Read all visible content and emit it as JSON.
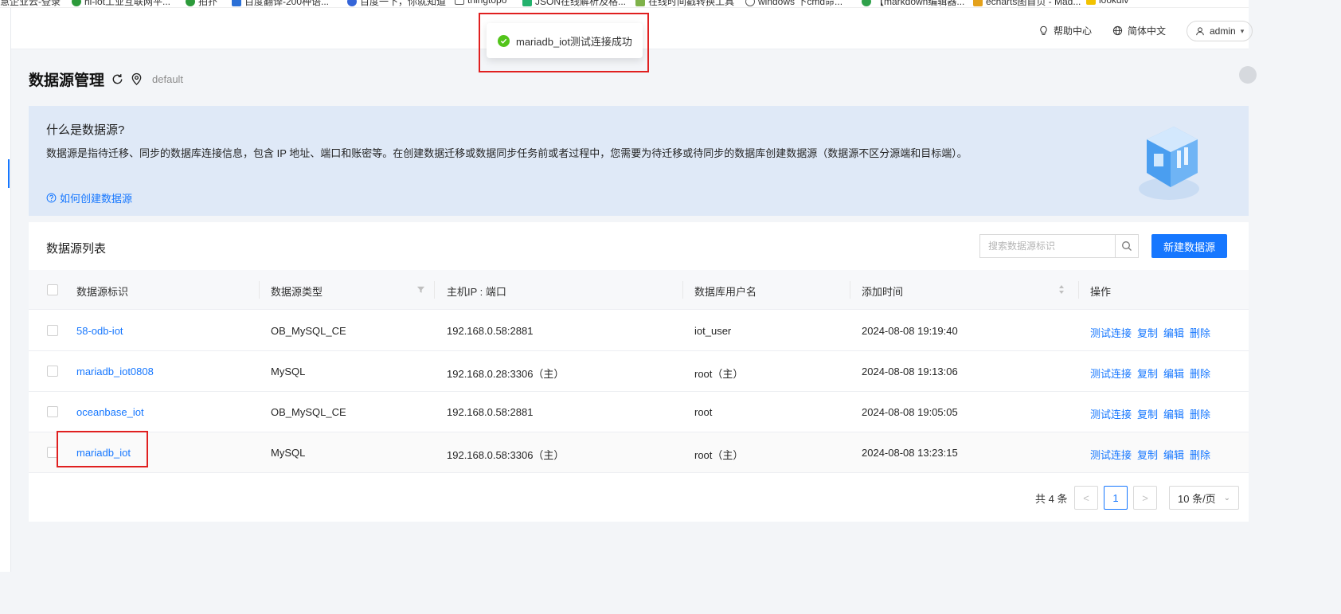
{
  "bookmarks": [
    {
      "label": "慧企业云-登录"
    },
    {
      "label": "hi-iot工业互联网平..."
    },
    {
      "label": "拍扑"
    },
    {
      "label": "百度翻译-200种语..."
    },
    {
      "label": "百度一下，你就知道"
    },
    {
      "label": "thingtopo"
    },
    {
      "label": "JSON在线解析及格..."
    },
    {
      "label": "在线时间戳转换工具"
    },
    {
      "label": "windows 下cmd命..."
    },
    {
      "label": "【markdown编辑器..."
    },
    {
      "label": "echarts图首页 - Mad..."
    },
    {
      "label": "lookdiv"
    }
  ],
  "header": {
    "help": "帮助中心",
    "language": "简体中文",
    "user": "admin"
  },
  "toast": {
    "message": "mariadb_iot测试连接成功",
    "status_color": "#52c41a"
  },
  "page": {
    "title": "数据源管理",
    "namespace": "default"
  },
  "banner": {
    "title": "什么是数据源?",
    "description": "数据源是指待迁移、同步的数据库连接信息，包含 IP 地址、端口和账密等。在创建数据迁移或数据同步任务前或者过程中，您需要为待迁移或待同步的数据库创建数据源（数据源不区分源端和目标端）。",
    "link": "如何创建数据源"
  },
  "list": {
    "title": "数据源列表",
    "search_placeholder": "搜索数据源标识",
    "new_button": "新建数据源",
    "columns": {
      "name": "数据源标识",
      "type": "数据源类型",
      "host": "主机IP : 端口",
      "user": "数据库用户名",
      "time": "添加时间",
      "ops": "操作"
    },
    "rows": [
      {
        "name": "58-odb-iot",
        "type": "OB_MySQL_CE",
        "host": "192.168.0.58:2881",
        "user": "iot_user",
        "time": "2024-08-08 19:19:40"
      },
      {
        "name": "mariadb_iot0808",
        "type": "MySQL",
        "host": "192.168.0.28:3306（主）",
        "user": "root（主）",
        "time": "2024-08-08 19:13:06"
      },
      {
        "name": "oceanbase_iot",
        "type": "OB_MySQL_CE",
        "host": "192.168.0.58:2881",
        "user": "root",
        "time": "2024-08-08 19:05:05"
      },
      {
        "name": "mariadb_iot",
        "type": "MySQL",
        "host": "192.168.0.58:3306（主）",
        "user": "root（主）",
        "time": "2024-08-08 13:23:15"
      }
    ],
    "actions": {
      "test": "测试连接",
      "copy": "复制",
      "edit": "编辑",
      "delete": "删除"
    }
  },
  "pagination": {
    "total": "共 4 条",
    "prev": "<",
    "current": "1",
    "next": ">",
    "page_size": "10 条/页"
  },
  "colors": {
    "primary": "#1677ff",
    "banner_bg": "#dfe9f7",
    "highlight_red": "#e02020"
  }
}
